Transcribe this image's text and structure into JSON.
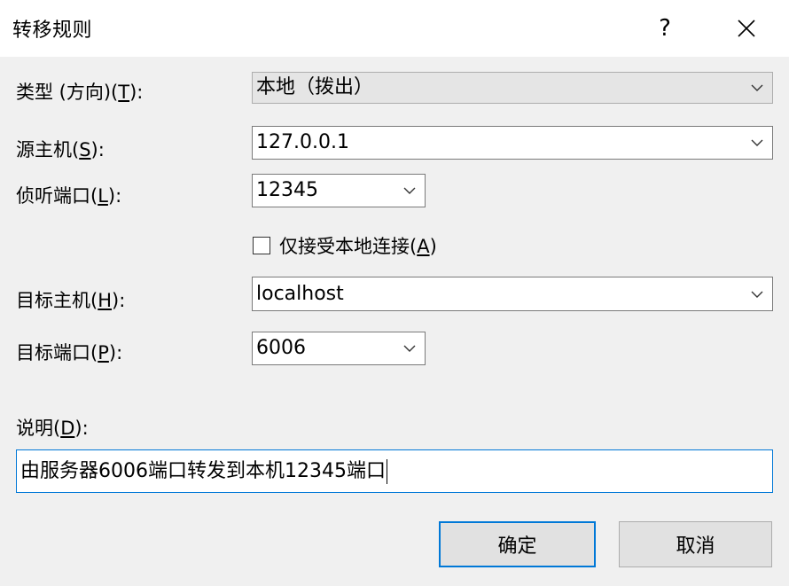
{
  "window": {
    "title": "转移规则",
    "help_glyph": "?",
    "close_icon": "close-icon"
  },
  "type_field": {
    "label_pre": "类型 (方向)(",
    "label_key": "T",
    "label_post": "):",
    "value": "本地（拨出）"
  },
  "source_host": {
    "label_pre": "源主机(",
    "label_key": "S",
    "label_post": "):",
    "value": "127.0.0.1"
  },
  "listen_port": {
    "label_pre": "侦听端口(",
    "label_key": "L",
    "label_post": "):",
    "value": "12345"
  },
  "local_only": {
    "label_pre": "仅接受本地连接(",
    "label_key": "A",
    "label_post": ")",
    "checked": false
  },
  "target_host": {
    "label_pre": "目标主机(",
    "label_key": "H",
    "label_post": "):",
    "value": "localhost"
  },
  "target_port": {
    "label_pre": "目标端口(",
    "label_key": "P",
    "label_post": "):",
    "value": "6006"
  },
  "description": {
    "label_pre": "说明(",
    "label_key": "D",
    "label_post": "):",
    "value": "由服务器6006端口转发到本机12345端口"
  },
  "buttons": {
    "ok": "确定",
    "cancel": "取消"
  },
  "colors": {
    "focus_blue": "#0078d7",
    "window_bg": "#f0f0f0"
  }
}
